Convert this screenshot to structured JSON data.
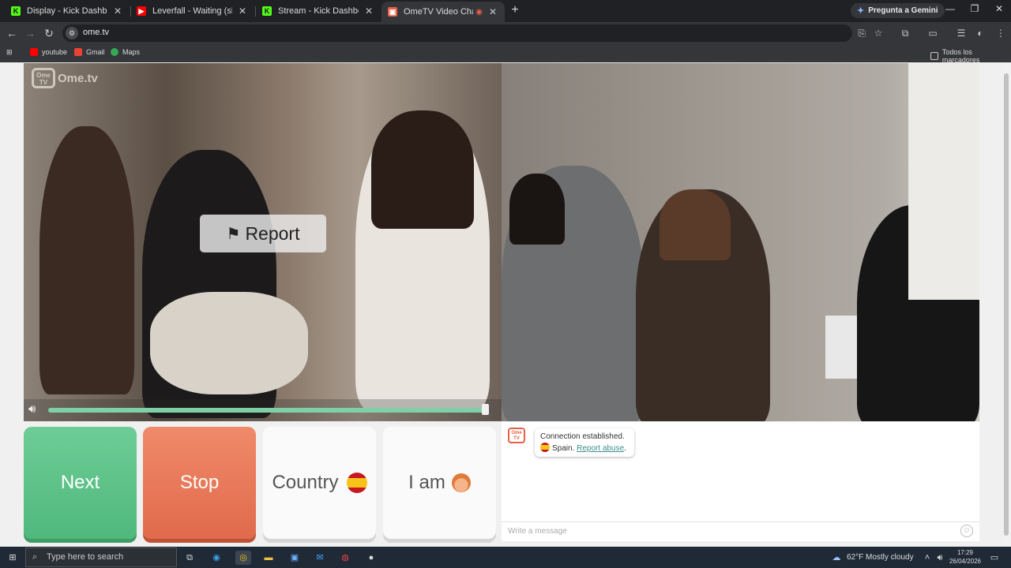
{
  "browser": {
    "tabs": [
      {
        "title": "Display - Kick Dashboard",
        "favicon": "kick-icon",
        "color": "#53fc18"
      },
      {
        "title": "Leverfall - Waiting (slowed) - Yo",
        "favicon": "youtube-icon",
        "color": "#ff0000"
      },
      {
        "title": "Stream - Kick Dashboard",
        "favicon": "kick-icon",
        "color": "#53fc18"
      },
      {
        "title": "OmeTV Video Chat — Ome",
        "favicon": "ometv-icon",
        "color": "#e86045",
        "active": true
      }
    ],
    "close_glyph": "✕",
    "new_tab": "+",
    "gemini_label": "Pregunta a Gemini",
    "url": "ome.tv",
    "bookmarks": [
      {
        "label": "youtube",
        "color": "#ff0000"
      },
      {
        "label": "Gmail",
        "color": "#ea4335"
      },
      {
        "label": "Maps",
        "color": "#34a853"
      }
    ],
    "all_bookmarks": "Todos los marcadores"
  },
  "ometv": {
    "logo_text": "Ome.tv",
    "logo_badge": "Ome TV",
    "report_label": "Report",
    "volume_level": 0.99,
    "buttons": {
      "next": "Next",
      "stop": "Stop",
      "country": "Country",
      "i_am": "I am"
    },
    "chat": {
      "message_line1": "Connection established.",
      "country": "Spain.",
      "report_link": "Report abuse",
      "period": ".",
      "placeholder": "Write a message"
    },
    "colors": {
      "next": "#5ec48a",
      "stop": "#e8785a",
      "link": "#3a8f8a"
    }
  },
  "taskbar": {
    "search_placeholder": "Type here to search",
    "weather": "62°F  Mostly cloudy",
    "time": "17:29",
    "date": "26/04/2026"
  }
}
